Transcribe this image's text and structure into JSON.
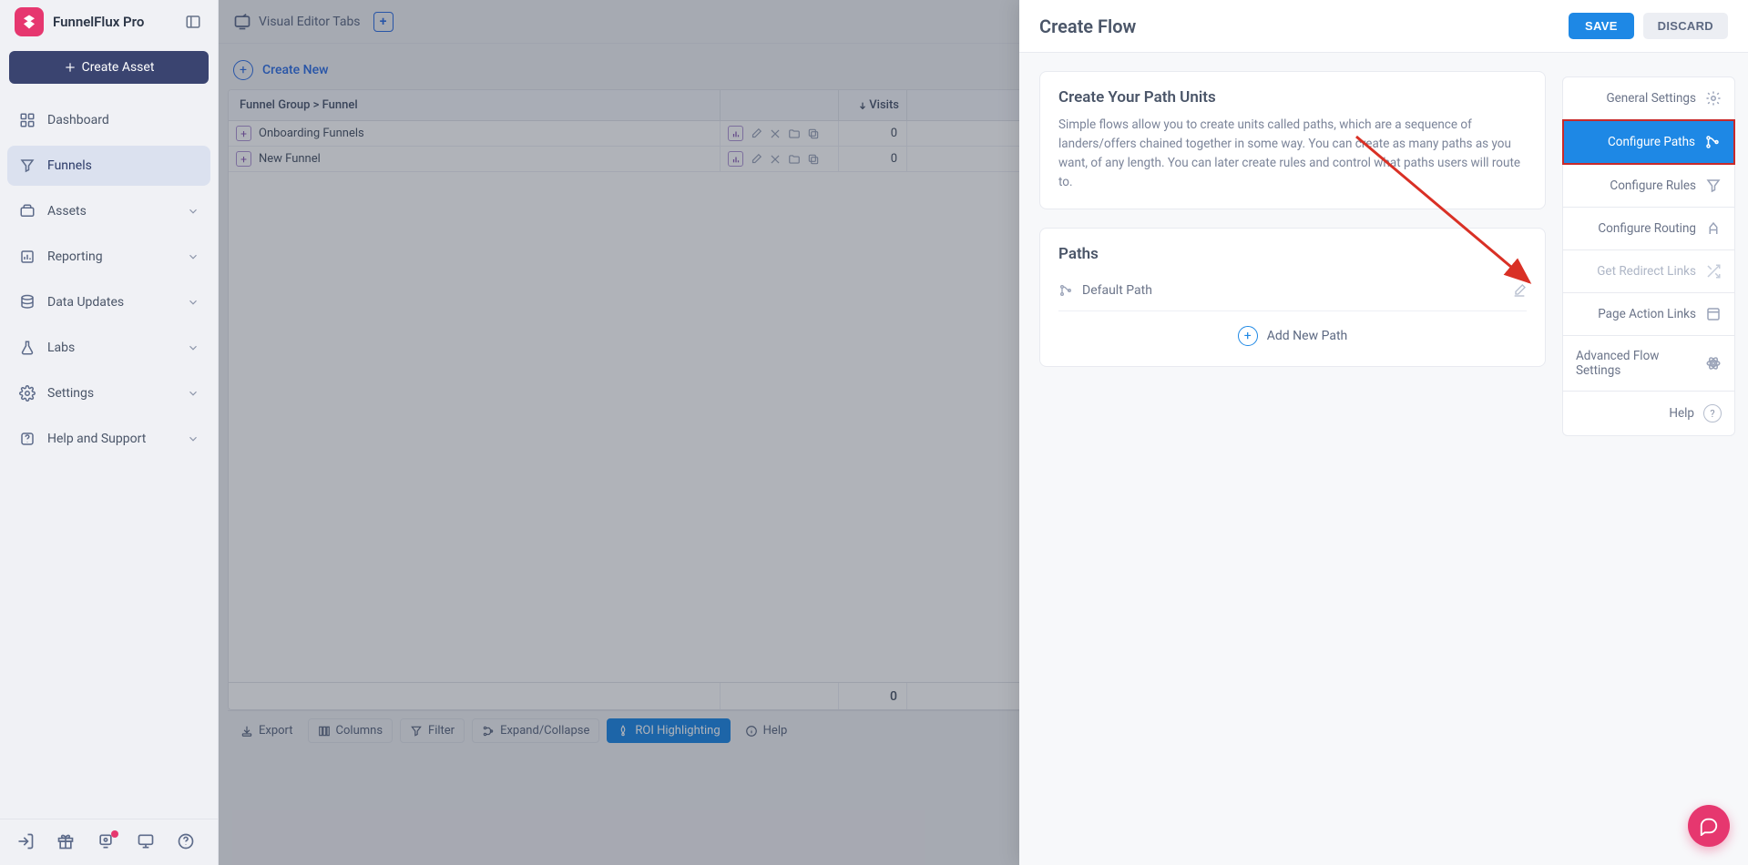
{
  "brand": "FunnelFlux Pro",
  "sidebar": {
    "create_asset": "Create Asset",
    "items": [
      {
        "label": "Dashboard"
      },
      {
        "label": "Funnels"
      },
      {
        "label": "Assets"
      },
      {
        "label": "Reporting"
      },
      {
        "label": "Data Updates"
      },
      {
        "label": "Labs"
      },
      {
        "label": "Settings"
      },
      {
        "label": "Help and Support"
      }
    ]
  },
  "topbar": {
    "visual_editor": "Visual Editor Tabs"
  },
  "content": {
    "create_new": "Create New",
    "th_name": "Funnel Group > Funnel",
    "th_visits": "Visits",
    "rows": [
      {
        "name": "Onboarding Funnels",
        "visits": "0"
      },
      {
        "name": "New Funnel",
        "visits": "0"
      }
    ],
    "footer_visits": "0"
  },
  "toolbar": {
    "export": "Export",
    "columns": "Columns",
    "filter": "Filter",
    "expand": "Expand/Collapse",
    "roi": "ROI Highlighting",
    "help": "Help"
  },
  "panel": {
    "title": "Create Flow",
    "save": "SAVE",
    "discard": "DISCARD",
    "intro_heading": "Create Your Path Units",
    "intro_body": "Simple flows allow you to create units called paths, which are a sequence of landers/offers chained together in some way. You can create as many paths as you want, of any length. You can later create rules and control what paths users will route to.",
    "paths_heading": "Paths",
    "default_path": "Default Path",
    "add_path": "Add New Path"
  },
  "rail": {
    "general": "General Settings",
    "configure_paths": "Configure Paths",
    "configure_rules": "Configure Rules",
    "configure_routing": "Configure Routing",
    "redirect_links": "Get Redirect Links",
    "page_action": "Page Action Links",
    "advanced": "Advanced Flow Settings",
    "help": "Help"
  }
}
